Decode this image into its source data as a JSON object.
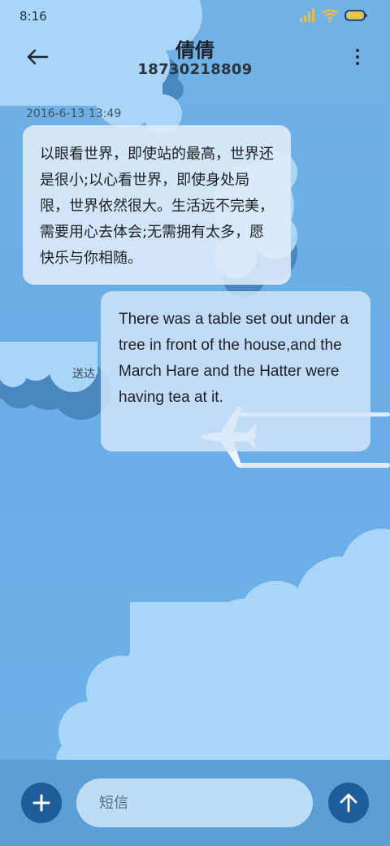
{
  "status_bar": {
    "time": "8:16",
    "icons": [
      "signal-icon",
      "wifi-icon",
      "battery-icon"
    ]
  },
  "header": {
    "contact_name": "倩倩",
    "contact_number": "18730218809",
    "back_icon": "arrow-left-icon",
    "more_icon": "more-vertical-icon"
  },
  "conversation": {
    "timestamp": "2016-6-13 13:49",
    "messages": [
      {
        "direction": "incoming",
        "text": "以眼看世界，即使站的最高，世界还是很小;以心看世界，即使身处局限，世界依然很大。生活远不完美，需要用心去体会;无需拥有太多，愿快乐与你相随。"
      },
      {
        "direction": "outgoing",
        "text": "There was a table set out under a tree in front of the house,and the March Hare and the Hatter were having tea at it.",
        "status": "送达"
      }
    ]
  },
  "compose": {
    "placeholder": "短信",
    "add_icon": "plus-icon",
    "send_icon": "arrow-up-icon"
  },
  "colors": {
    "sky": "#6aaee6",
    "cloud_light": "#a9d5f7",
    "cloud_dark": "#4a86bf",
    "button": "#1f5f99",
    "compose_bar": "#5b9fd7",
    "input_bg": "#bfdcf5",
    "battery": "#f5c542"
  }
}
